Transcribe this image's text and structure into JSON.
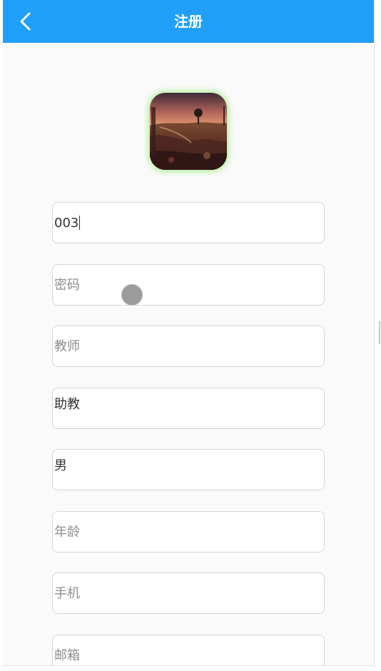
{
  "header": {
    "title": "注册",
    "background_color": "#209ff9",
    "back_icon": "chevron-left-icon"
  },
  "avatar": {
    "description_icon": "avatar-landscape-photo",
    "glow_color": "#b8f0a0"
  },
  "form": {
    "account": {
      "value": "003"
    },
    "password": {
      "placeholder": "密码"
    },
    "role": {
      "placeholder": "教师"
    },
    "title_field": {
      "value": "助教"
    },
    "gender": {
      "value": "男"
    },
    "age": {
      "placeholder": "年龄"
    },
    "phone": {
      "placeholder": "手机"
    },
    "email": {
      "placeholder": "邮箱"
    }
  }
}
